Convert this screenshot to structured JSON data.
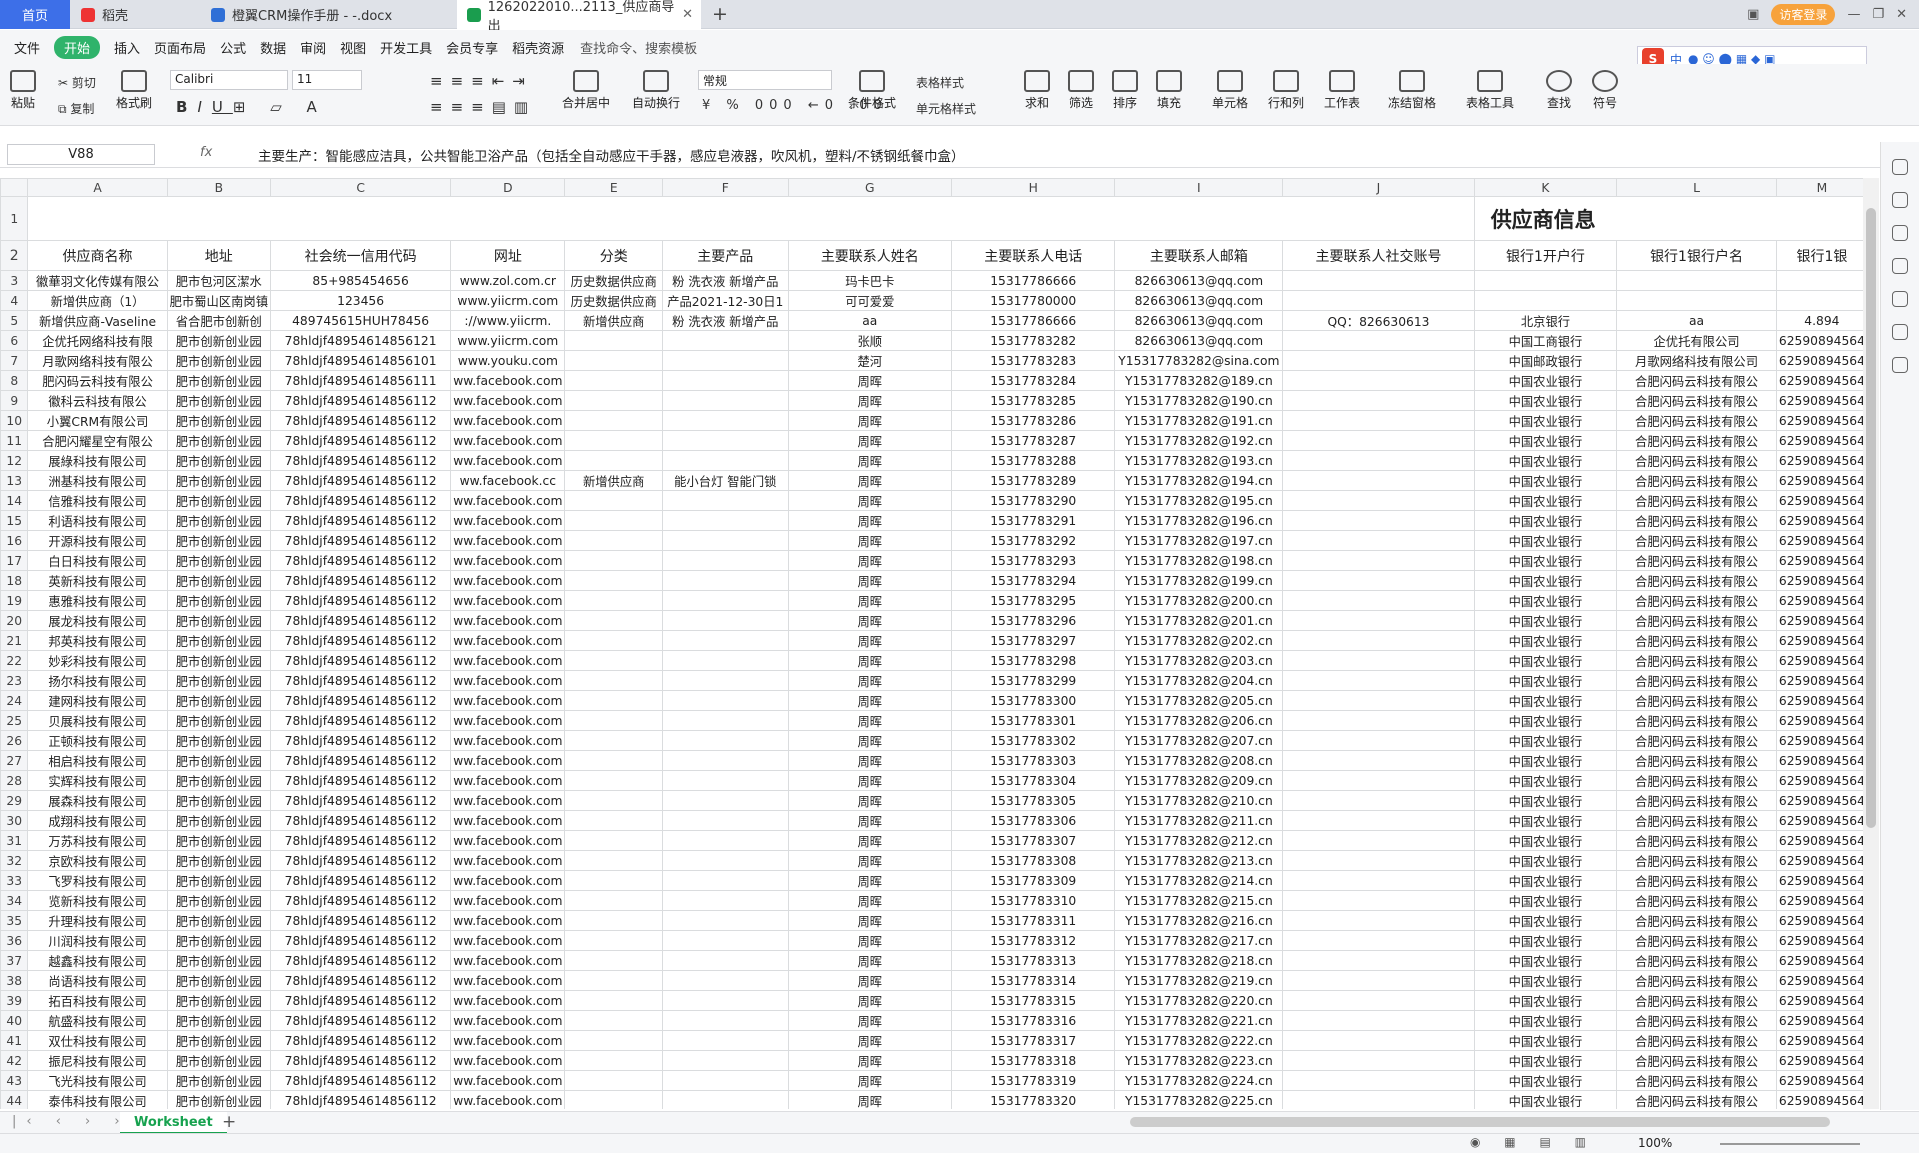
{
  "tabs": {
    "home": "首页",
    "daoke": "稻壳",
    "doc": "橙翼CRM操作手册 - -.docx",
    "xls": "1262022010...2113_供应商导出"
  },
  "topbar": {
    "visitor": "访客登录"
  },
  "menu": [
    "文件",
    "开始",
    "插入",
    "页面布局",
    "公式",
    "数据",
    "审阅",
    "视图",
    "开发工具",
    "会员专享",
    "稻壳资源"
  ],
  "menu_search": "查找命令、搜索模板",
  "ribbon": {
    "paste": "粘贴",
    "cut": "剪切",
    "copy": "复制",
    "format_painter": "格式刷",
    "font": "Calibri",
    "size": "11",
    "merge": "合并居中",
    "wrap": "自动换行",
    "numfmt": "常规",
    "cond": "条件格式",
    "tablestyle": "表格样式",
    "cellstyle": "单元格样式",
    "sum": "求和",
    "filter": "筛选",
    "sort": "排序",
    "fill": "填充",
    "cell": "单元格",
    "rowcol": "行和列",
    "sheet": "工作表",
    "freeze": "冻结窗格",
    "tabletool": "表格工具",
    "find": "查找",
    "symbol": "符号"
  },
  "sogou": {
    "logo": "S",
    "lang": "中"
  },
  "namebox": "V88",
  "fx": "fx",
  "formula": "主要生产：智能感应洁具，公共智能卫浴产品（包括全自动感应干手器，感应皂液器，吹风机，塑料/不锈钢纸餐巾盒）",
  "columns": [
    "A",
    "B",
    "C",
    "D",
    "E",
    "F",
    "G",
    "H",
    "I",
    "J",
    "K",
    "L",
    "M"
  ],
  "title": "供应商信息",
  "headers": [
    "供应商名称",
    "地址",
    "社会统一信用代码",
    "网址",
    "分类",
    "主要产品",
    "主要联系人姓名",
    "主要联系人电话",
    "主要联系人邮箱",
    "主要联系人社交账号",
    "银行1开户行",
    "银行1银行户名",
    "银行1银"
  ],
  "rows": [
    [
      "3",
      "徽華羽文化传媒有限公",
      "肥市包河区潔水",
      "85+985454656",
      "www.zol.com.cr",
      "历史数据供应商",
      "粉 洗衣液 新增产品",
      "玛卡巴卡",
      "15317786666",
      "826630613@qq.com",
      "",
      "",
      ""
    ],
    [
      "4",
      "新增供应商（1）",
      "肥市蜀山区南岗镇",
      "123456",
      "www.yiicrm.com",
      "历史数据供应商",
      "产品2021-12-30日1",
      "可可爱爱",
      "15317780000",
      "826630613@qq.com",
      "",
      "",
      ""
    ],
    [
      "5",
      "新增供应商-Vaseline",
      "省合肥市创新创",
      "489745615HUH78456",
      "://www.yiicrm.",
      "新增供应商",
      "粉 洗衣液 新增产品",
      "aa",
      "15317786666",
      "826630613@qq.com",
      "QQ：826630613",
      "北京银行",
      "aa"
    ],
    [
      "6",
      "企优托网络科技有限",
      "肥市创新创业园",
      "78hldjf48954614856121",
      "www.yiicrm.com",
      "",
      "",
      "张顺",
      "15317783282",
      "826630613@qq.com",
      "",
      "中国工商银行",
      "企优托有限公司"
    ],
    [
      "7",
      "月歌网络科技有限公",
      "肥市创新创业园",
      "78hldjf48954614856101",
      "www.youku.com",
      "",
      "",
      "楚河",
      "15317783283",
      "Y15317783282@sina.com",
      "",
      "中国邮政银行",
      "月歌网络科技有限公司"
    ],
    [
      "8",
      "肥闪码云科技有限公",
      "肥市创新创业园",
      "78hldjf48954614856111",
      "ww.facebook.com",
      "",
      "",
      "周晖",
      "15317783284",
      "Y15317783282@189.cn",
      "",
      "中国农业银行",
      "合肥闪码云科技有限公"
    ],
    [
      "9",
      "徽科云科技有限公",
      "肥市创新创业园",
      "78hldjf48954614856112",
      "ww.facebook.com",
      "",
      "",
      "周晖",
      "15317783285",
      "Y15317783282@190.cn",
      "",
      "中国农业银行",
      "合肥闪码云科技有限公"
    ],
    [
      "10",
      "小翼CRM有限公司",
      "肥市创新创业园",
      "78hldjf48954614856112",
      "ww.facebook.com",
      "",
      "",
      "周晖",
      "15317783286",
      "Y15317783282@191.cn",
      "",
      "中国农业银行",
      "合肥闪码云科技有限公"
    ],
    [
      "11",
      "合肥闪耀星空有限公",
      "肥市创新创业园",
      "78hldjf48954614856112",
      "ww.facebook.com",
      "",
      "",
      "周晖",
      "15317783287",
      "Y15317783282@192.cn",
      "",
      "中国农业银行",
      "合肥闪码云科技有限公"
    ],
    [
      "12",
      "展綠科技有限公司",
      "肥市创新创业园",
      "78hldjf48954614856112",
      "ww.facebook.com",
      "",
      "",
      "周晖",
      "15317783288",
      "Y15317783282@193.cn",
      "",
      "中国农业银行",
      "合肥闪码云科技有限公"
    ],
    [
      "13",
      "洲基科技有限公司",
      "肥市创新创业园",
      "78hldjf48954614856112",
      "ww.facebook.cc",
      "新增供应商",
      "能小台灯 智能门锁",
      "周晖",
      "15317783289",
      "Y15317783282@194.cn",
      "",
      "中国农业银行",
      "合肥闪码云科技有限公"
    ],
    [
      "14",
      "信雅科技有限公司",
      "肥市创新创业园",
      "78hldjf48954614856112",
      "ww.facebook.com",
      "",
      "",
      "周晖",
      "15317783290",
      "Y15317783282@195.cn",
      "",
      "中国农业银行",
      "合肥闪码云科技有限公"
    ],
    [
      "15",
      "利语科技有限公司",
      "肥市创新创业园",
      "78hldjf48954614856112",
      "ww.facebook.com",
      "",
      "",
      "周晖",
      "15317783291",
      "Y15317783282@196.cn",
      "",
      "中国农业银行",
      "合肥闪码云科技有限公"
    ],
    [
      "16",
      "开源科技有限公司",
      "肥市创新创业园",
      "78hldjf48954614856112",
      "ww.facebook.com",
      "",
      "",
      "周晖",
      "15317783292",
      "Y15317783282@197.cn",
      "",
      "中国农业银行",
      "合肥闪码云科技有限公"
    ],
    [
      "17",
      "白日科技有限公司",
      "肥市创新创业园",
      "78hldjf48954614856112",
      "ww.facebook.com",
      "",
      "",
      "周晖",
      "15317783293",
      "Y15317783282@198.cn",
      "",
      "中国农业银行",
      "合肥闪码云科技有限公"
    ],
    [
      "18",
      "英新科技有限公司",
      "肥市创新创业园",
      "78hldjf48954614856112",
      "ww.facebook.com",
      "",
      "",
      "周晖",
      "15317783294",
      "Y15317783282@199.cn",
      "",
      "中国农业银行",
      "合肥闪码云科技有限公"
    ],
    [
      "19",
      "惠雅科技有限公司",
      "肥市创新创业园",
      "78hldjf48954614856112",
      "ww.facebook.com",
      "",
      "",
      "周晖",
      "15317783295",
      "Y15317783282@200.cn",
      "",
      "中国农业银行",
      "合肥闪码云科技有限公"
    ],
    [
      "20",
      "展龙科技有限公司",
      "肥市创新创业园",
      "78hldjf48954614856112",
      "ww.facebook.com",
      "",
      "",
      "周晖",
      "15317783296",
      "Y15317783282@201.cn",
      "",
      "中国农业银行",
      "合肥闪码云科技有限公"
    ],
    [
      "21",
      "邦英科技有限公司",
      "肥市创新创业园",
      "78hldjf48954614856112",
      "ww.facebook.com",
      "",
      "",
      "周晖",
      "15317783297",
      "Y15317783282@202.cn",
      "",
      "中国农业银行",
      "合肥闪码云科技有限公"
    ],
    [
      "22",
      "妙彩科技有限公司",
      "肥市创新创业园",
      "78hldjf48954614856112",
      "ww.facebook.com",
      "",
      "",
      "周晖",
      "15317783298",
      "Y15317783282@203.cn",
      "",
      "中国农业银行",
      "合肥闪码云科技有限公"
    ],
    [
      "23",
      "扬尔科技有限公司",
      "肥市创新创业园",
      "78hldjf48954614856112",
      "ww.facebook.com",
      "",
      "",
      "周晖",
      "15317783299",
      "Y15317783282@204.cn",
      "",
      "中国农业银行",
      "合肥闪码云科技有限公"
    ],
    [
      "24",
      "建网科技有限公司",
      "肥市创新创业园",
      "78hldjf48954614856112",
      "ww.facebook.com",
      "",
      "",
      "周晖",
      "15317783300",
      "Y15317783282@205.cn",
      "",
      "中国农业银行",
      "合肥闪码云科技有限公"
    ],
    [
      "25",
      "贝展科技有限公司",
      "肥市创新创业园",
      "78hldjf48954614856112",
      "ww.facebook.com",
      "",
      "",
      "周晖",
      "15317783301",
      "Y15317783282@206.cn",
      "",
      "中国农业银行",
      "合肥闪码云科技有限公"
    ],
    [
      "26",
      "正顿科技有限公司",
      "肥市创新创业园",
      "78hldjf48954614856112",
      "ww.facebook.com",
      "",
      "",
      "周晖",
      "15317783302",
      "Y15317783282@207.cn",
      "",
      "中国农业银行",
      "合肥闪码云科技有限公"
    ],
    [
      "27",
      "相启科技有限公司",
      "肥市创新创业园",
      "78hldjf48954614856112",
      "ww.facebook.com",
      "",
      "",
      "周晖",
      "15317783303",
      "Y15317783282@208.cn",
      "",
      "中国农业银行",
      "合肥闪码云科技有限公"
    ],
    [
      "28",
      "实辉科技有限公司",
      "肥市创新创业园",
      "78hldjf48954614856112",
      "ww.facebook.com",
      "",
      "",
      "周晖",
      "15317783304",
      "Y15317783282@209.cn",
      "",
      "中国农业银行",
      "合肥闪码云科技有限公"
    ],
    [
      "29",
      "展森科技有限公司",
      "肥市创新创业园",
      "78hldjf48954614856112",
      "ww.facebook.com",
      "",
      "",
      "周晖",
      "15317783305",
      "Y15317783282@210.cn",
      "",
      "中国农业银行",
      "合肥闪码云科技有限公"
    ],
    [
      "30",
      "成翔科技有限公司",
      "肥市创新创业园",
      "78hldjf48954614856112",
      "ww.facebook.com",
      "",
      "",
      "周晖",
      "15317783306",
      "Y15317783282@211.cn",
      "",
      "中国农业银行",
      "合肥闪码云科技有限公"
    ],
    [
      "31",
      "万苏科技有限公司",
      "肥市创新创业园",
      "78hldjf48954614856112",
      "ww.facebook.com",
      "",
      "",
      "周晖",
      "15317783307",
      "Y15317783282@212.cn",
      "",
      "中国农业银行",
      "合肥闪码云科技有限公"
    ],
    [
      "32",
      "京欧科技有限公司",
      "肥市创新创业园",
      "78hldjf48954614856112",
      "ww.facebook.com",
      "",
      "",
      "周晖",
      "15317783308",
      "Y15317783282@213.cn",
      "",
      "中国农业银行",
      "合肥闪码云科技有限公"
    ],
    [
      "33",
      "飞罗科技有限公司",
      "肥市创新创业园",
      "78hldjf48954614856112",
      "ww.facebook.com",
      "",
      "",
      "周晖",
      "15317783309",
      "Y15317783282@214.cn",
      "",
      "中国农业银行",
      "合肥闪码云科技有限公"
    ],
    [
      "34",
      "览新科技有限公司",
      "肥市创新创业园",
      "78hldjf48954614856112",
      "ww.facebook.com",
      "",
      "",
      "周晖",
      "15317783310",
      "Y15317783282@215.cn",
      "",
      "中国农业银行",
      "合肥闪码云科技有限公"
    ],
    [
      "35",
      "升理科技有限公司",
      "肥市创新创业园",
      "78hldjf48954614856112",
      "ww.facebook.com",
      "",
      "",
      "周晖",
      "15317783311",
      "Y15317783282@216.cn",
      "",
      "中国农业银行",
      "合肥闪码云科技有限公"
    ],
    [
      "36",
      "川润科技有限公司",
      "肥市创新创业园",
      "78hldjf48954614856112",
      "ww.facebook.com",
      "",
      "",
      "周晖",
      "15317783312",
      "Y15317783282@217.cn",
      "",
      "中国农业银行",
      "合肥闪码云科技有限公"
    ],
    [
      "37",
      "越鑫科技有限公司",
      "肥市创新创业园",
      "78hldjf48954614856112",
      "ww.facebook.com",
      "",
      "",
      "周晖",
      "15317783313",
      "Y15317783282@218.cn",
      "",
      "中国农业银行",
      "合肥闪码云科技有限公"
    ],
    [
      "38",
      "尚语科技有限公司",
      "肥市创新创业园",
      "78hldjf48954614856112",
      "ww.facebook.com",
      "",
      "",
      "周晖",
      "15317783314",
      "Y15317783282@219.cn",
      "",
      "中国农业银行",
      "合肥闪码云科技有限公"
    ],
    [
      "39",
      "拓百科技有限公司",
      "肥市创新创业园",
      "78hldjf48954614856112",
      "ww.facebook.com",
      "",
      "",
      "周晖",
      "15317783315",
      "Y15317783282@220.cn",
      "",
      "中国农业银行",
      "合肥闪码云科技有限公"
    ],
    [
      "40",
      "航盛科技有限公司",
      "肥市创新创业园",
      "78hldjf48954614856112",
      "ww.facebook.com",
      "",
      "",
      "周晖",
      "15317783316",
      "Y15317783282@221.cn",
      "",
      "中国农业银行",
      "合肥闪码云科技有限公"
    ],
    [
      "41",
      "双仕科技有限公司",
      "肥市创新创业园",
      "78hldjf48954614856112",
      "ww.facebook.com",
      "",
      "",
      "周晖",
      "15317783317",
      "Y15317783282@222.cn",
      "",
      "中国农业银行",
      "合肥闪码云科技有限公"
    ],
    [
      "42",
      "振尼科技有限公司",
      "肥市创新创业园",
      "78hldjf48954614856112",
      "ww.facebook.com",
      "",
      "",
      "周晖",
      "15317783318",
      "Y15317783282@223.cn",
      "",
      "中国农业银行",
      "合肥闪码云科技有限公"
    ],
    [
      "43",
      "飞光科技有限公司",
      "肥市创新创业园",
      "78hldjf48954614856112",
      "ww.facebook.com",
      "",
      "",
      "周晖",
      "15317783319",
      "Y15317783282@224.cn",
      "",
      "中国农业银行",
      "合肥闪码云科技有限公"
    ],
    [
      "44",
      "泰伟科技有限公司",
      "肥市创新创业园",
      "78hldjf48954614856112",
      "ww.facebook.com",
      "",
      "",
      "周晖",
      "15317783320",
      "Y15317783282@225.cn",
      "",
      "中国农业银行",
      "合肥闪码云科技有限公"
    ]
  ],
  "colM_values": [
    "",
    "",
    "4.894",
    "62590894564",
    "62590894564",
    "62590894564"
  ],
  "sheet_tab": "Worksheet",
  "zoom": "100%"
}
